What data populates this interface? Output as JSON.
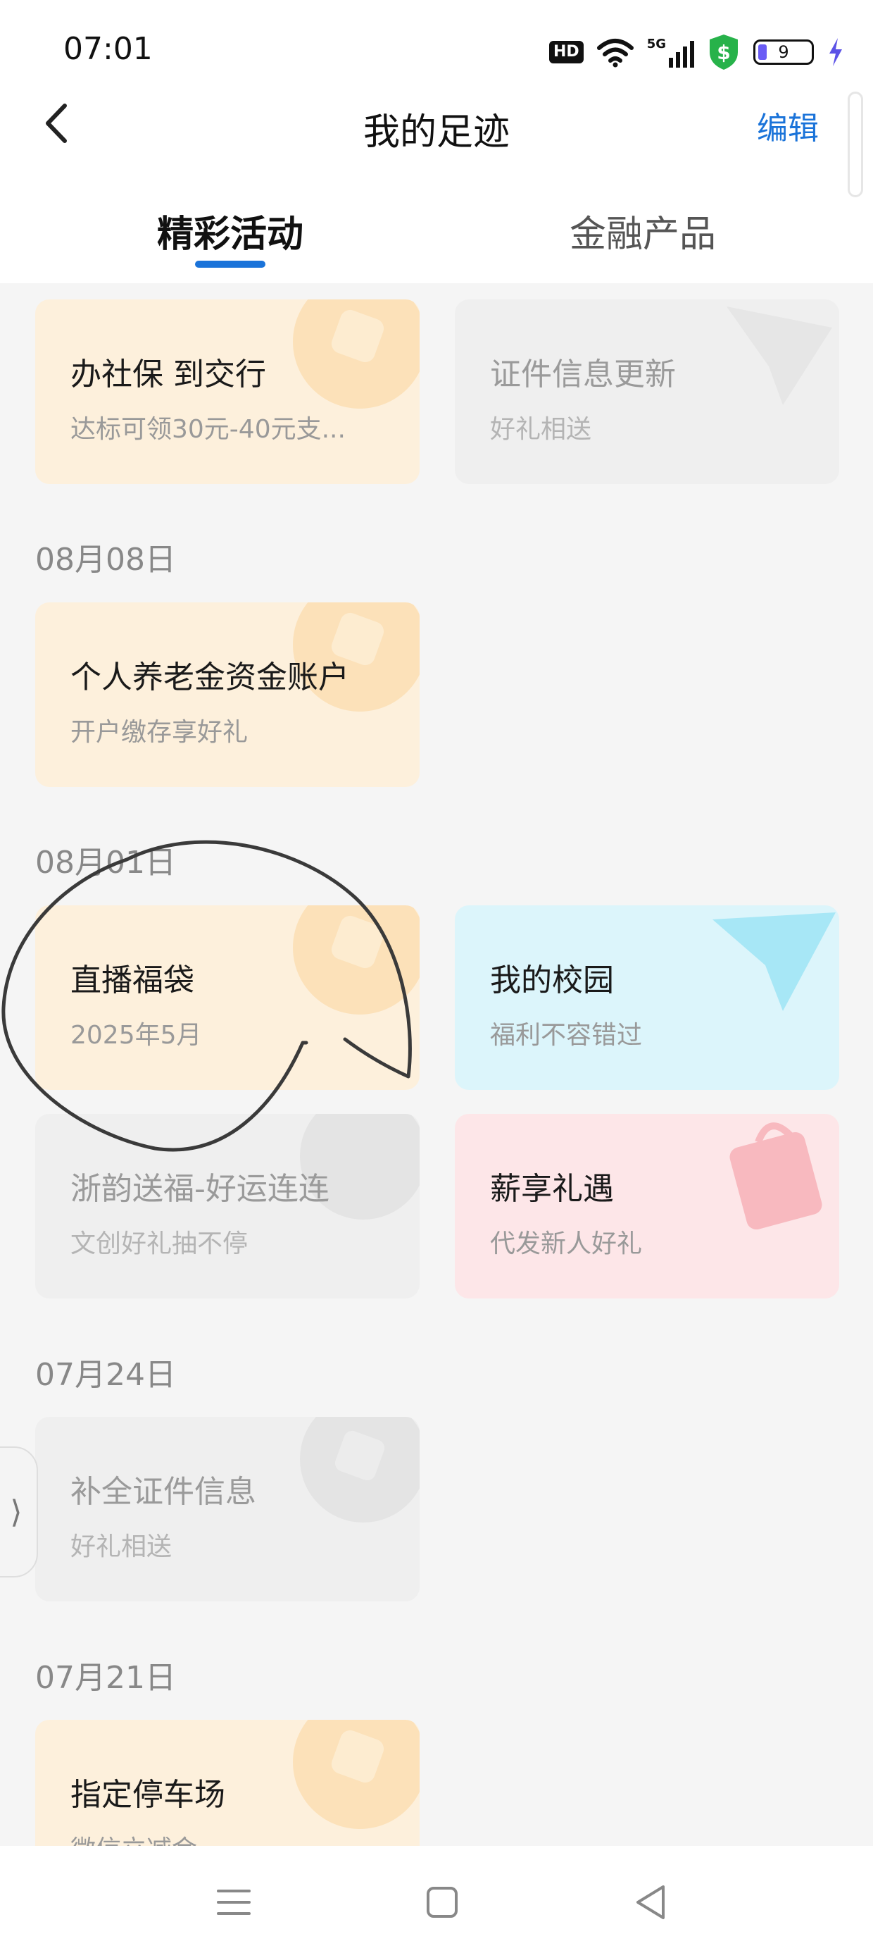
{
  "status_bar": {
    "time": "07:01",
    "hd_badge": "HD",
    "network": "5G",
    "battery_level": "9",
    "icons": [
      "hd-icon",
      "wifi-icon",
      "signal-5g-icon",
      "security-shield-icon",
      "battery-icon",
      "charging-icon"
    ]
  },
  "header": {
    "title": "我的足迹",
    "edit_label": "编辑",
    "back_icon": "chevron-left-icon"
  },
  "tabs": [
    {
      "label": "精彩活动",
      "active": true
    },
    {
      "label": "金融产品",
      "active": false
    }
  ],
  "colors": {
    "accent": "#1a73d9",
    "card_orange": "#fdf0dc",
    "card_gray": "#efefef",
    "card_cyan": "#dcf5fb",
    "card_pink": "#fde6e8"
  },
  "sections": [
    {
      "date": "",
      "cards": [
        {
          "title": "办社保 到交行",
          "subtitle": "达标可领30元-40元支...",
          "style": "orange"
        },
        {
          "title": "证件信息更新",
          "subtitle": "好礼相送",
          "style": "gray"
        }
      ]
    },
    {
      "date": "08月08日",
      "cards": [
        {
          "title": "个人养老金资金账户",
          "subtitle": "开户缴存享好礼",
          "style": "orange"
        }
      ]
    },
    {
      "date": "08月01日",
      "cards": [
        {
          "title": "直播福袋",
          "subtitle": "2025年5月",
          "style": "orange"
        },
        {
          "title": "我的校园",
          "subtitle": "福利不容错过",
          "style": "cyan"
        },
        {
          "title": "浙韵送福-好运连连",
          "subtitle": "文创好礼抽不停",
          "style": "gray"
        },
        {
          "title": "薪享礼遇",
          "subtitle": "代发新人好礼",
          "style": "pink"
        }
      ]
    },
    {
      "date": "07月24日",
      "cards": [
        {
          "title": "补全证件信息",
          "subtitle": "好礼相送",
          "style": "gray"
        }
      ]
    },
    {
      "date": "07月21日",
      "cards": [
        {
          "title": "指定停车场",
          "subtitle": "微信立减金",
          "style": "orange"
        }
      ]
    }
  ],
  "side_handle_glyph": "⟩",
  "nav_bar": [
    "menu-icon",
    "home-square-icon",
    "back-triangle-icon"
  ]
}
